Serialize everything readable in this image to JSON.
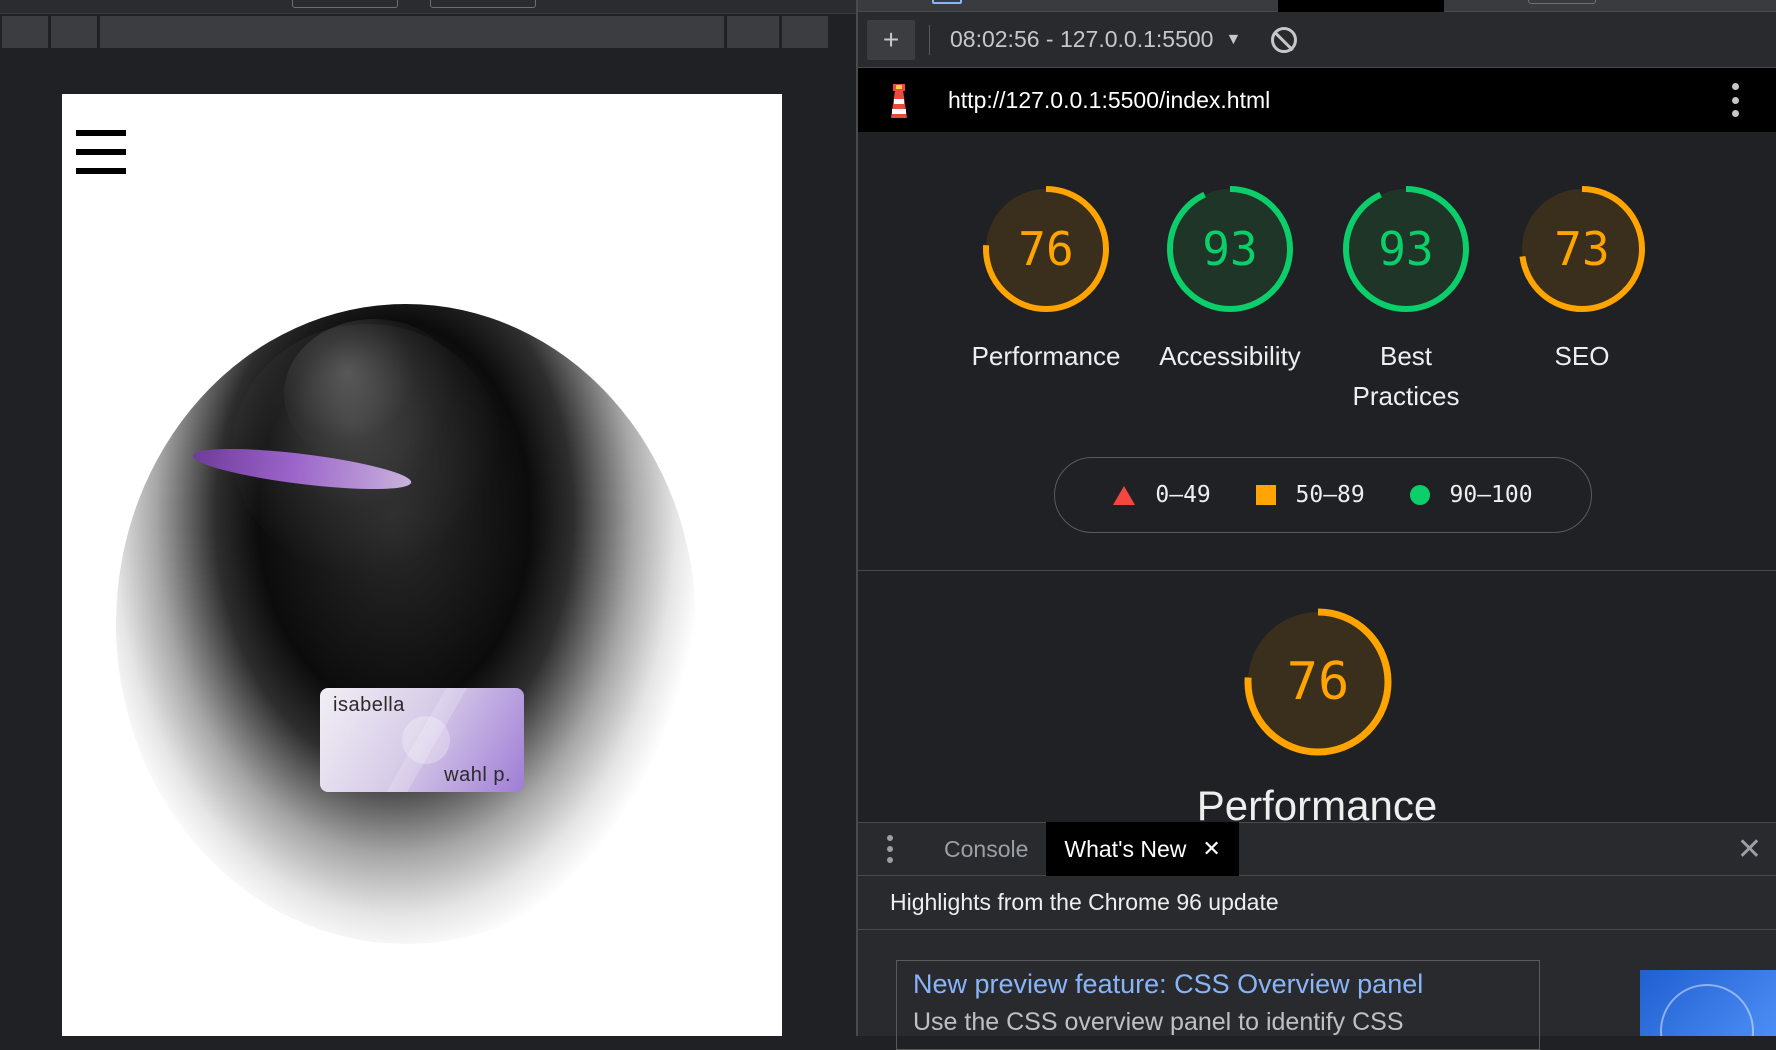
{
  "viewport": {
    "card_first_name": "isabella",
    "card_last_name": "wahl p."
  },
  "toolbar": {
    "add_label": "+",
    "report_selector": "08:02:56 - 127.0.0.1:5500",
    "caret": "▼"
  },
  "report": {
    "url": "http://127.0.0.1:5500/index.html",
    "gauges": [
      {
        "label": "Performance",
        "score": "76",
        "value": 76,
        "rating": "average"
      },
      {
        "label": "Accessibility",
        "score": "93",
        "value": 93,
        "rating": "pass"
      },
      {
        "label": "Best Practices",
        "score": "93",
        "value": 93,
        "rating": "pass"
      },
      {
        "label": "SEO",
        "score": "73",
        "value": 73,
        "rating": "average"
      }
    ],
    "legend": {
      "fail": "0–49",
      "average": "50–89",
      "pass": "90–100"
    },
    "section": {
      "score": "76",
      "value": 76,
      "label": "Performance"
    }
  },
  "colors": {
    "average": "#ffa400",
    "average_bg": "#3a2e1c",
    "pass": "#0cce6b",
    "pass_bg": "#1e3527",
    "fail": "#f4473f"
  },
  "drawer": {
    "tabs": [
      "Console",
      "What's New"
    ],
    "close_glyph": "✕",
    "highlights": "Highlights from the Chrome 96 update",
    "feature_title": "New preview feature: CSS Overview panel",
    "feature_desc": "Use the CSS overview panel to identify CSS"
  }
}
